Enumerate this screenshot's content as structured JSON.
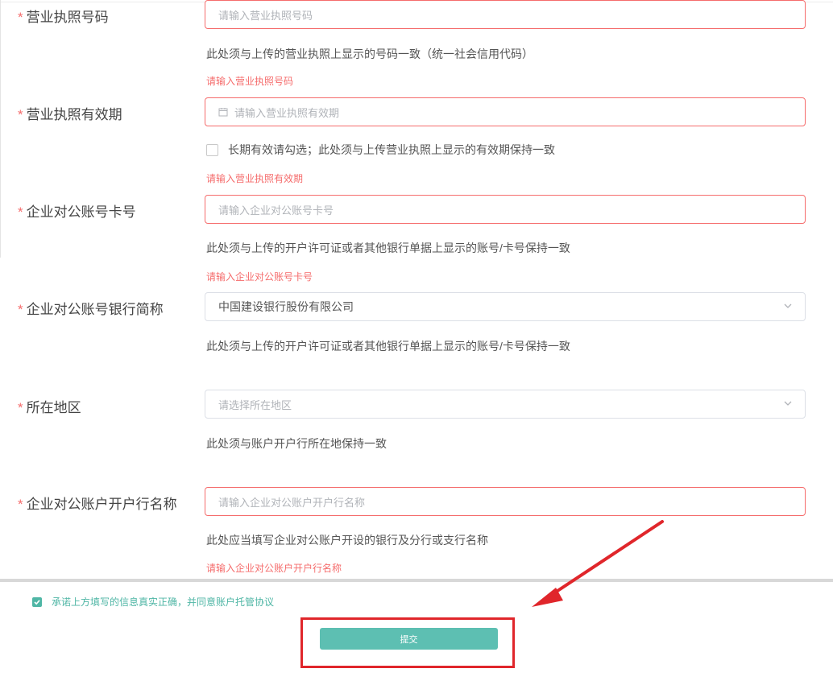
{
  "form": {
    "license_number": {
      "label": "营业执照号码",
      "placeholder": "请输入营业执照号码",
      "hint": "此处须与上传的营业执照上显示的号码一致（统一社会信用代码）",
      "error": "请输入营业执照号码"
    },
    "license_validity": {
      "label": "营业执照有效期",
      "placeholder": "请输入营业执照有效期",
      "checkbox_label": "长期有效请勾选；此处须与上传营业执照上显示的有效期保持一致",
      "error": "请输入营业执照有效期"
    },
    "account_number": {
      "label": "企业对公账号卡号",
      "placeholder": "请输入企业对公账号卡号",
      "hint": "此处须与上传的开户许可证或者其他银行单据上显示的账号/卡号保持一致",
      "error": "请输入企业对公账号卡号"
    },
    "bank_short_name": {
      "label": "企业对公账号银行简称",
      "value": "中国建设银行股份有限公司",
      "hint": "此处须与上传的开户许可证或者其他银行单据上显示的账号/卡号保持一致"
    },
    "region": {
      "label": "所在地区",
      "placeholder": "请选择所在地区",
      "hint": "此处须与账户开户行所在地保持一致"
    },
    "branch_name": {
      "label": "企业对公账户开户行名称",
      "placeholder": "请输入企业对公账户开户行名称",
      "hint": "此处应当填写企业对公账户开设的银行及分行或支行名称",
      "error": "请输入企业对公账户开户行名称"
    },
    "required_mark": "*"
  },
  "footer": {
    "agree_text": "承诺上方填写的信息真实正确，并同意账户托管协议",
    "submit_label": "提交"
  },
  "colors": {
    "error": "#f56c6c",
    "accent": "#5dbfb2",
    "annotation": "#e0262b"
  }
}
